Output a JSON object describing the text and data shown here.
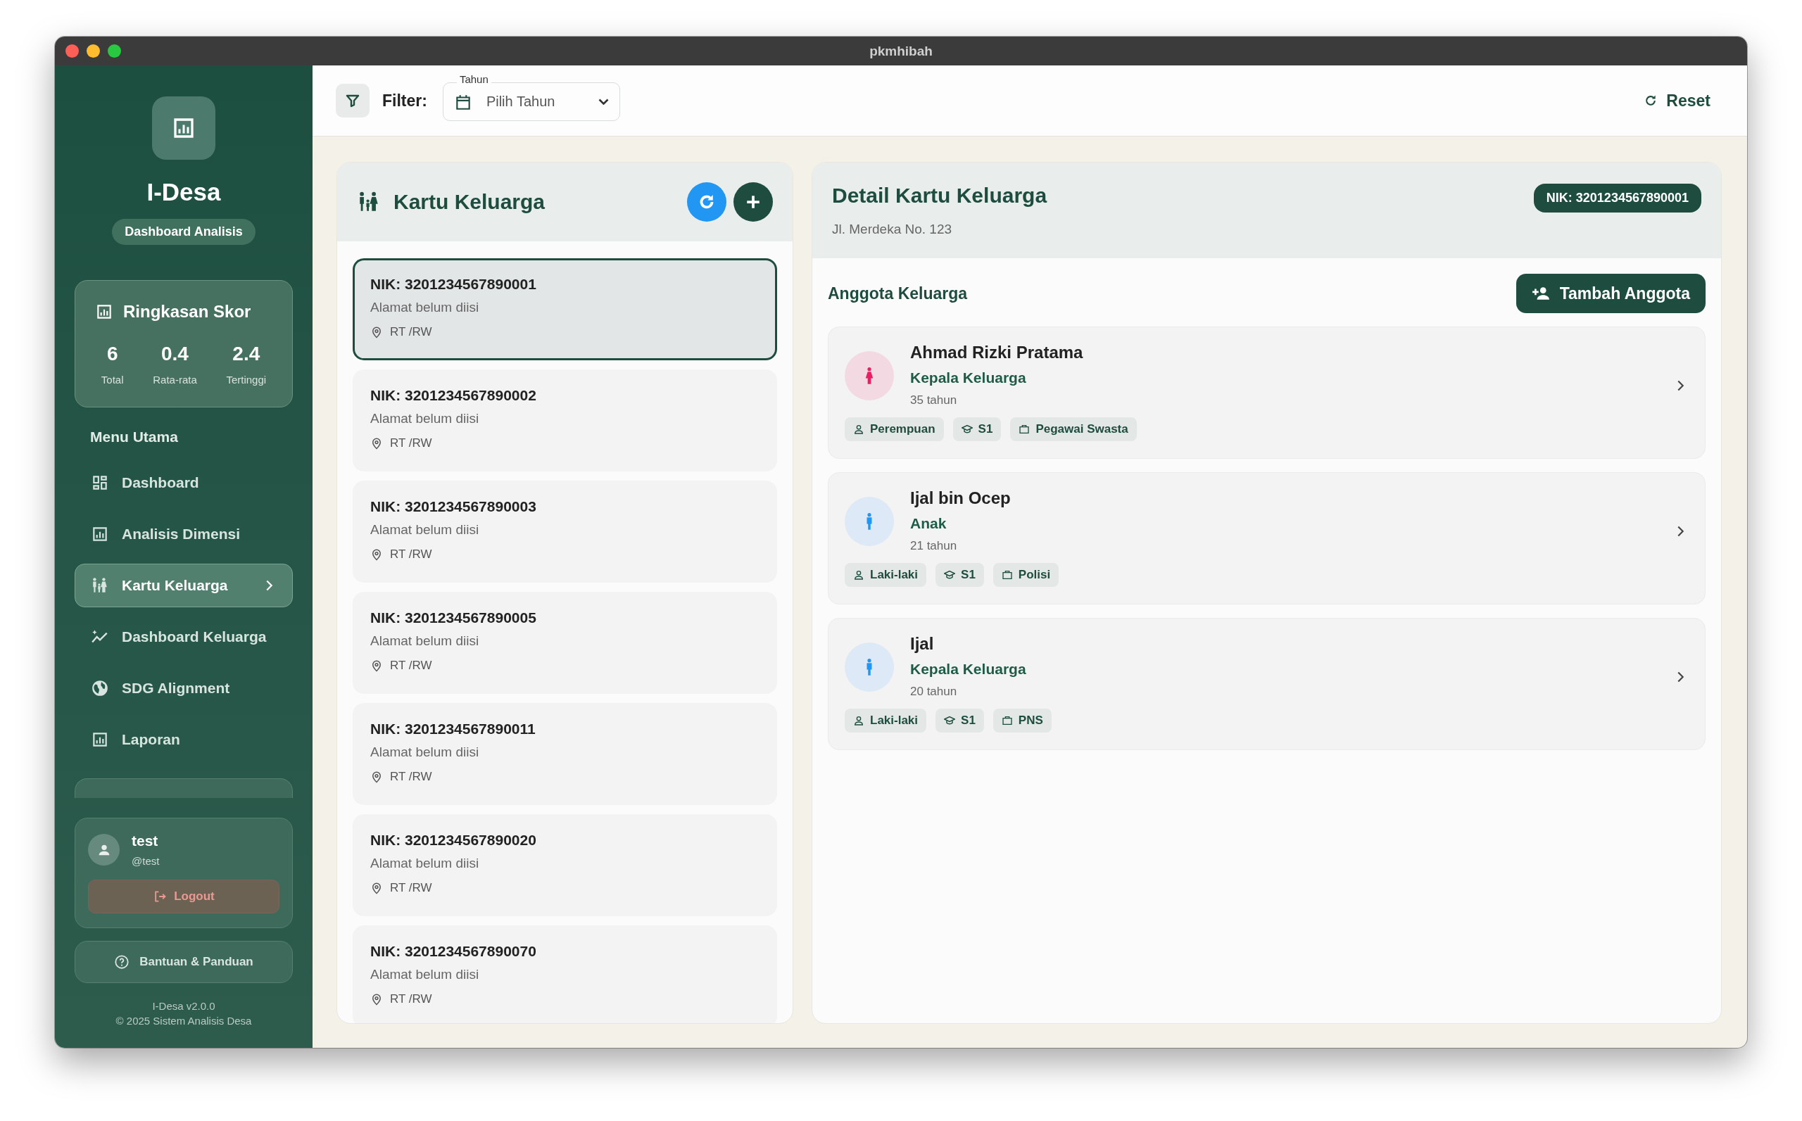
{
  "window": {
    "title": "pkmhibah"
  },
  "sidebar": {
    "app_name": "I-Desa",
    "badge": "Dashboard Analisis",
    "summary": {
      "title": "Ringkasan Skor",
      "stats": [
        {
          "value": "6",
          "label": "Total"
        },
        {
          "value": "0.4",
          "label": "Rata-rata"
        },
        {
          "value": "2.4",
          "label": "Tertinggi"
        }
      ]
    },
    "menu_title": "Menu Utama",
    "items": [
      {
        "label": "Dashboard",
        "selected": false
      },
      {
        "label": "Analisis Dimensi",
        "selected": false
      },
      {
        "label": "Kartu Keluarga",
        "selected": true
      },
      {
        "label": "Dashboard Keluarga",
        "selected": false
      },
      {
        "label": "SDG Alignment",
        "selected": false
      },
      {
        "label": "Laporan",
        "selected": false
      }
    ],
    "user": {
      "name": "test",
      "handle": "@test",
      "logout": "Logout"
    },
    "help": "Bantuan & Panduan",
    "footer": [
      "I-Desa v2.0.0",
      "© 2025 Sistem Analisis Desa"
    ]
  },
  "filter_bar": {
    "label": "Filter:",
    "year_field": {
      "label": "Tahun",
      "placeholder": "Pilih Tahun"
    },
    "reset": "Reset"
  },
  "family_list": {
    "title": "Kartu Keluarga",
    "cards": [
      {
        "nik": "NIK: 3201234567890001",
        "address": "Alamat belum diisi",
        "rt_rw": "RT /RW",
        "selected": true
      },
      {
        "nik": "NIK: 3201234567890002",
        "address": "Alamat belum diisi",
        "rt_rw": "RT /RW",
        "selected": false
      },
      {
        "nik": "NIK: 3201234567890003",
        "address": "Alamat belum diisi",
        "rt_rw": "RT /RW",
        "selected": false
      },
      {
        "nik": "NIK: 3201234567890005",
        "address": "Alamat belum diisi",
        "rt_rw": "RT /RW",
        "selected": false
      },
      {
        "nik": "NIK: 3201234567890011",
        "address": "Alamat belum diisi",
        "rt_rw": "RT /RW",
        "selected": false
      },
      {
        "nik": "NIK: 3201234567890020",
        "address": "Alamat belum diisi",
        "rt_rw": "RT /RW",
        "selected": false
      },
      {
        "nik": "NIK: 3201234567890070",
        "address": "Alamat belum diisi",
        "rt_rw": "RT /RW",
        "selected": false
      }
    ]
  },
  "detail": {
    "title": "Detail Kartu Keluarga",
    "address": "Jl. Merdeka No. 123",
    "nik_badge": "NIK: 3201234567890001",
    "members_title": "Anggota Keluarga",
    "add_button": "Tambah Anggota",
    "members": [
      {
        "name": "Ahmad Rizki Pratama",
        "role": "Kepala Keluarga",
        "age": "35 tahun",
        "kind": "female",
        "gender": "Perempuan",
        "education": "S1",
        "job": "Pegawai Swasta"
      },
      {
        "name": "Ijal bin Ocep",
        "role": "Anak",
        "age": "21 tahun",
        "kind": "male",
        "gender": "Laki-laki",
        "education": "S1",
        "job": "Polisi"
      },
      {
        "name": "Ijal",
        "role": "Kepala Keluarga",
        "age": "20 tahun",
        "kind": "male",
        "gender": "Laki-laki",
        "education": "S1",
        "job": "PNS"
      }
    ]
  }
}
